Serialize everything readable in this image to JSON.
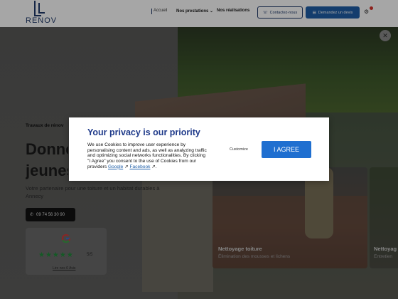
{
  "header": {
    "logo_text": "RENOV",
    "nav": {
      "accueil": "Accueil",
      "prestations": "Nos prestations",
      "realisations": "Nos réalisations"
    },
    "contact_label": "Contactez-nous",
    "quote_label": "Demandez un devis"
  },
  "hero": {
    "kicker": "Travaux de rénov",
    "title_line1": "Donnez",
    "title_line2": "jeunes",
    "description": "Votre partenaire pour une toiture et un habitat durables à Annecy",
    "phone": "09 74 56 30 90",
    "review": {
      "stars": "★★★★★",
      "rating": "5/5",
      "link": "Lire nos 6 Avis"
    }
  },
  "cards": [
    {
      "title": "Nettoyage toiture",
      "subtitle": "Élimination des mousses et lichens"
    },
    {
      "title": "Nettoyag",
      "subtitle": "Entretien"
    }
  ],
  "privacy": {
    "title": "Your privacy is our priority",
    "body": "We use Cookies to improve user experience by personalising content and ads, as well as analyzing traffic and optimizing social networks functionalities. By clicking \"I Agree\" you consent to the use of Cookies from our providers",
    "link_google": "Google",
    "link_facebook": "Facebook",
    "customize_label": "Customize",
    "agree_label": "I AGREE"
  },
  "colors": {
    "brand": "#1f3a6b",
    "accent": "#1f5fa8",
    "agree": "#1f6fd0",
    "title": "#1f3a8a",
    "stars": "#1f8a3a"
  }
}
